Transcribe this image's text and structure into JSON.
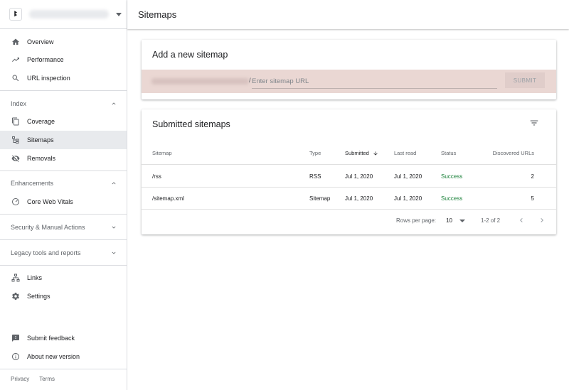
{
  "property": {
    "favicon_text": "ꔪ"
  },
  "nav": {
    "overview": "Overview",
    "performance": "Performance",
    "url_inspection": "URL inspection",
    "index_header": "Index",
    "coverage": "Coverage",
    "sitemaps": "Sitemaps",
    "removals": "Removals",
    "enhancements_header": "Enhancements",
    "core_web_vitals": "Core Web Vitals",
    "security_header": "Security & Manual Actions",
    "legacy_header": "Legacy tools and reports",
    "links": "Links",
    "settings": "Settings",
    "submit_feedback": "Submit feedback",
    "about_new_version": "About new version"
  },
  "footer": {
    "privacy": "Privacy",
    "terms": "Terms"
  },
  "header": {
    "title": "Sitemaps"
  },
  "add_sitemap": {
    "title": "Add a new sitemap",
    "url_separator": "/",
    "placeholder": "Enter sitemap URL",
    "submit_label": "SUBMIT"
  },
  "submitted": {
    "title": "Submitted sitemaps",
    "columns": {
      "sitemap": "Sitemap",
      "type": "Type",
      "submitted": "Submitted",
      "last_read": "Last read",
      "status": "Status",
      "discovered": "Discovered URLs"
    },
    "rows": [
      {
        "sitemap": "/rss",
        "type": "RSS",
        "submitted": "Jul 1, 2020",
        "last_read": "Jul 1, 2020",
        "status": "Success",
        "discovered": "2"
      },
      {
        "sitemap": "/sitemap.xml",
        "type": "Sitemap",
        "submitted": "Jul 1, 2020",
        "last_read": "Jul 1, 2020",
        "status": "Success",
        "discovered": "5"
      }
    ],
    "pager": {
      "rows_per_page_label": "Rows per page:",
      "rows_per_page": "10",
      "range": "1-2 of 2"
    }
  },
  "colors": {
    "status_success": "#188038",
    "active_nav": "#e8eaed",
    "add_row_bg": "#ead7d3"
  }
}
